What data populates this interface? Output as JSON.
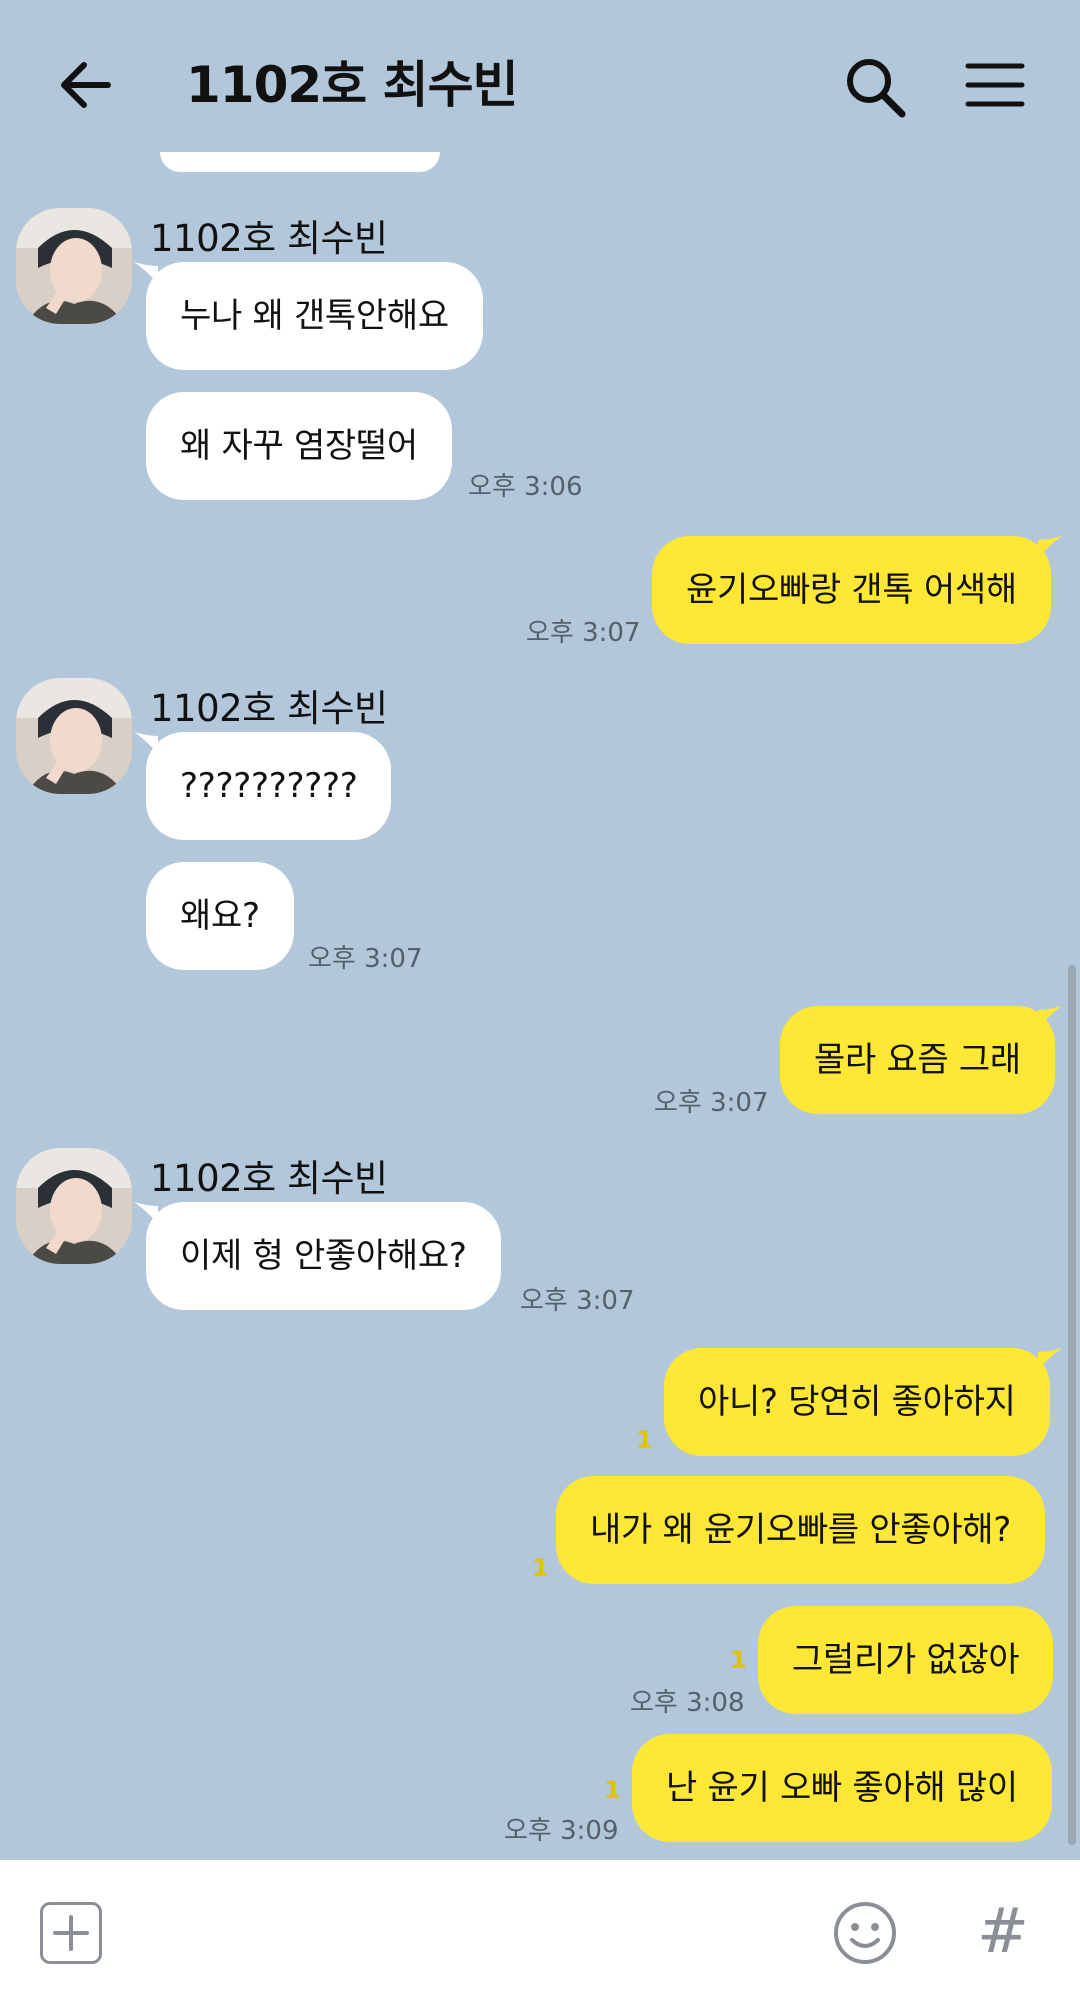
{
  "header": {
    "title": "1102호 최수빈"
  },
  "messages": {
    "sender_name": "1102호 최수빈",
    "m1": {
      "text": "누나 왜 갠톡안해요"
    },
    "m2": {
      "text": "왜 자꾸 염장떨어",
      "time": "오후 3:06"
    },
    "m3": {
      "text": "윤기오빠랑 갠톡 어색해",
      "time": "오후 3:07"
    },
    "m4": {
      "text": "??????????"
    },
    "m5": {
      "text": "왜요?",
      "time": "오후 3:07"
    },
    "m6": {
      "text": "몰라 요즘 그래",
      "time": "오후 3:07"
    },
    "m7": {
      "text": "이제 형 안좋아해요?",
      "time": "오후 3:07"
    },
    "m8": {
      "text": "아니? 당연히 좋아하지",
      "unread": "1"
    },
    "m9": {
      "text": "내가 왜 윤기오빠를 안좋아해?",
      "unread": "1"
    },
    "m10": {
      "text": "그럴리가 없잖아",
      "unread": "1",
      "time": "오후 3:08"
    },
    "m11": {
      "text": "난 윤기 오빠 좋아해 많이",
      "unread": "1",
      "time": "오후 3:09"
    }
  },
  "input": {
    "hash_label": "#"
  },
  "colors": {
    "background": "#b2c7da",
    "outgoing_bubble": "#fee835",
    "incoming_bubble": "#ffffff"
  },
  "icons": {
    "back": "arrow-left-icon",
    "search": "search-icon",
    "menu": "hamburger-menu-icon",
    "plus": "plus-icon",
    "emoji": "emoji-icon",
    "hash": "hash-icon"
  }
}
